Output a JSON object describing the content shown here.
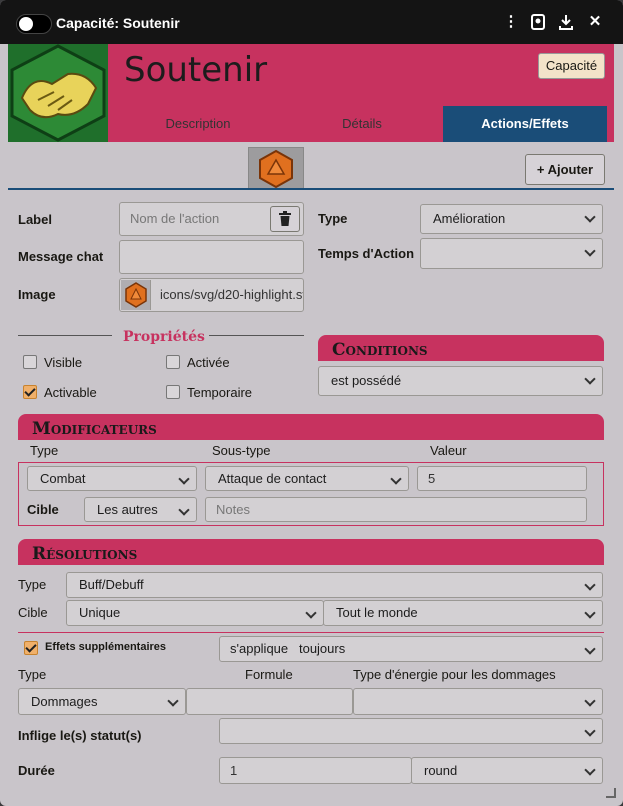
{
  "window": {
    "title": "Capacité: Soutenir"
  },
  "header": {
    "name": "Soutenir",
    "badge": "Capacité"
  },
  "tabs": [
    {
      "label": "Description"
    },
    {
      "label": "Détails"
    },
    {
      "label": "Actions/Effets"
    }
  ],
  "toolbar": {
    "add_label": "+ Ajouter"
  },
  "action": {
    "label_label": "Label",
    "label_placeholder": "Nom de l'action",
    "message_label": "Message chat",
    "message_value": "",
    "image_label": "Image",
    "image_value": "icons/svg/d20-highlight.svg",
    "type_label": "Type",
    "type_value": "Amélioration",
    "temps_label": "Temps d'Action",
    "temps_value": ""
  },
  "proprietes": {
    "title": "Propriétés",
    "items": [
      {
        "label": "Visible",
        "checked": false
      },
      {
        "label": "Activée",
        "checked": false
      },
      {
        "label": "Activable",
        "checked": true
      },
      {
        "label": "Temporaire",
        "checked": false
      }
    ]
  },
  "conditions": {
    "title": "Conditions",
    "value": "est possédé"
  },
  "modificateurs": {
    "title": "Modificateurs",
    "col_type": "Type",
    "col_soustype": "Sous-type",
    "col_valeur": "Valeur",
    "type_value": "Combat",
    "soustype_value": "Attaque de contact",
    "valeur_value": "5",
    "cible_label": "Cible",
    "cible_value": "Les autres",
    "notes_placeholder": "Notes"
  },
  "resolutions": {
    "title": "Résolutions",
    "type_label": "Type",
    "type_value": "Buff/Debuff",
    "cible_label": "Cible",
    "cible_value": "Unique",
    "cible2_value": "Tout le monde",
    "effets_label": "Effets supplémentaires",
    "effets_checked": true,
    "applique_value": "s'applique   toujours",
    "col_type": "Type",
    "col_formule": "Formule",
    "col_energie": "Type d'énergie pour les dommages",
    "dommages_value": "Dommages",
    "formule_value": "",
    "energie_value": "",
    "statut_label": "Inflige le(s) statut(s)",
    "statut_value": "",
    "duree_label": "Durée",
    "duree_value": "1",
    "duree_unit": "round"
  },
  "colors": {
    "accent": "#c7325f",
    "tab_active": "#1a4d78",
    "checkbox": "#f0b06a"
  }
}
